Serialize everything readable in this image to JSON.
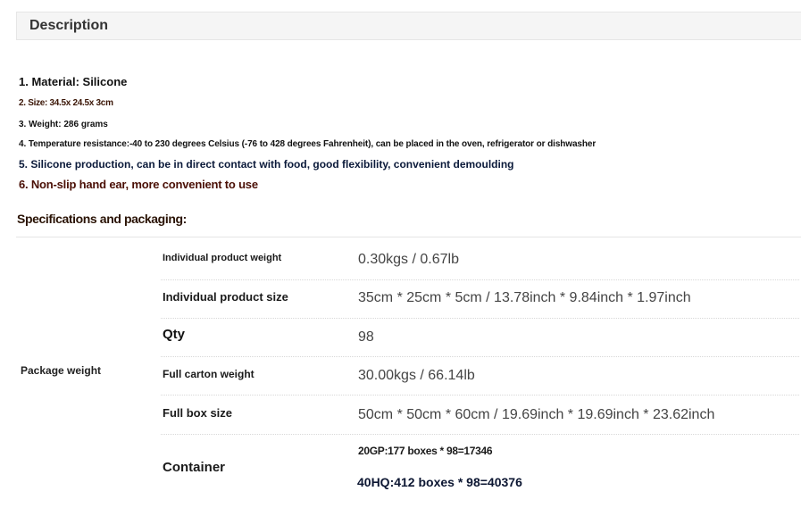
{
  "description": {
    "title": "Description",
    "features": [
      "1. Material: Silicone",
      "2. Size: 34.5x 24.5x 3cm",
      "3. Weight: 286 grams",
      "4. Temperature resistance:-40 to 230 degrees Celsius (-76 to 428 degrees Fahrenheit), can be placed in the oven, refrigerator or dishwasher",
      "5. Silicone production, can be in direct contact with food, good flexibility, convenient demoulding",
      "6. Non-slip hand ear, more convenient to use"
    ]
  },
  "specs": {
    "title": "Specifications and packaging:",
    "group_label": "Package weight",
    "rows": [
      {
        "label": "Individual product weight",
        "value": "0.30kgs / 0.67lb"
      },
      {
        "label": "Individual product size",
        "value": "35cm * 25cm * 5cm / 13.78inch * 9.84inch * 1.97inch"
      },
      {
        "label": "Qty",
        "value": "98"
      },
      {
        "label": "Full carton weight",
        "value": "30.00kgs / 66.14lb"
      },
      {
        "label": "Full box size",
        "value": "50cm * 50cm * 60cm / 19.69inch * 19.69inch * 23.62inch"
      }
    ],
    "container": {
      "label": "Container",
      "values": [
        "20GP:177 boxes * 98=17346",
        "40HQ:412 boxes * 98=40376"
      ]
    }
  }
}
